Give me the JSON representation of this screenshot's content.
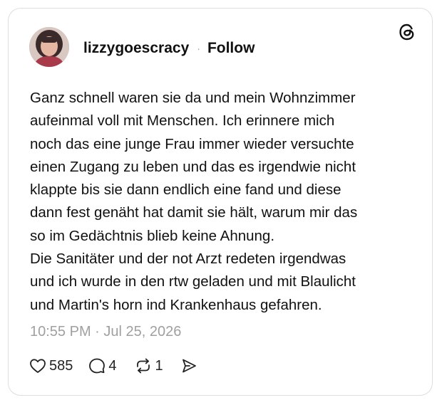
{
  "post": {
    "username": "lizzygoescracy",
    "separator": "·",
    "follow_label": "Follow",
    "lines": [
      "Ganz schnell waren sie da und mein Wohnzimmer",
      "aufeinmal voll mit Menschen. Ich erinnere mich",
      "noch das eine junge Frau immer wieder versuchte",
      "einen Zugang zu leben und das es irgendwie nicht",
      "klappte bis sie dann endlich eine fand und diese",
      "dann fest genäht hat damit sie hält, warum mir das",
      "so im Gedächtnis blieb keine Ahnung.",
      "Die Sanitäter und der not Arzt redeten irgendwas",
      "und ich wurde in den rtw geladen und mit Blaulicht",
      "und Martin's horn ind Krankenhaus gefahren."
    ],
    "timestamp": "10:55 PM · Jul 25, 2026"
  },
  "actions": {
    "like_count": "585",
    "comment_count": "4",
    "repost_count": "1"
  },
  "icons": {
    "logo": "threads-logo-icon",
    "like": "heart-icon",
    "comment": "comment-bubble-icon",
    "repost": "repost-icon",
    "share": "share-send-icon"
  },
  "colors": {
    "text": "#111111",
    "muted": "#a0a0a0",
    "border": "#dedede",
    "background": "#ffffff"
  }
}
